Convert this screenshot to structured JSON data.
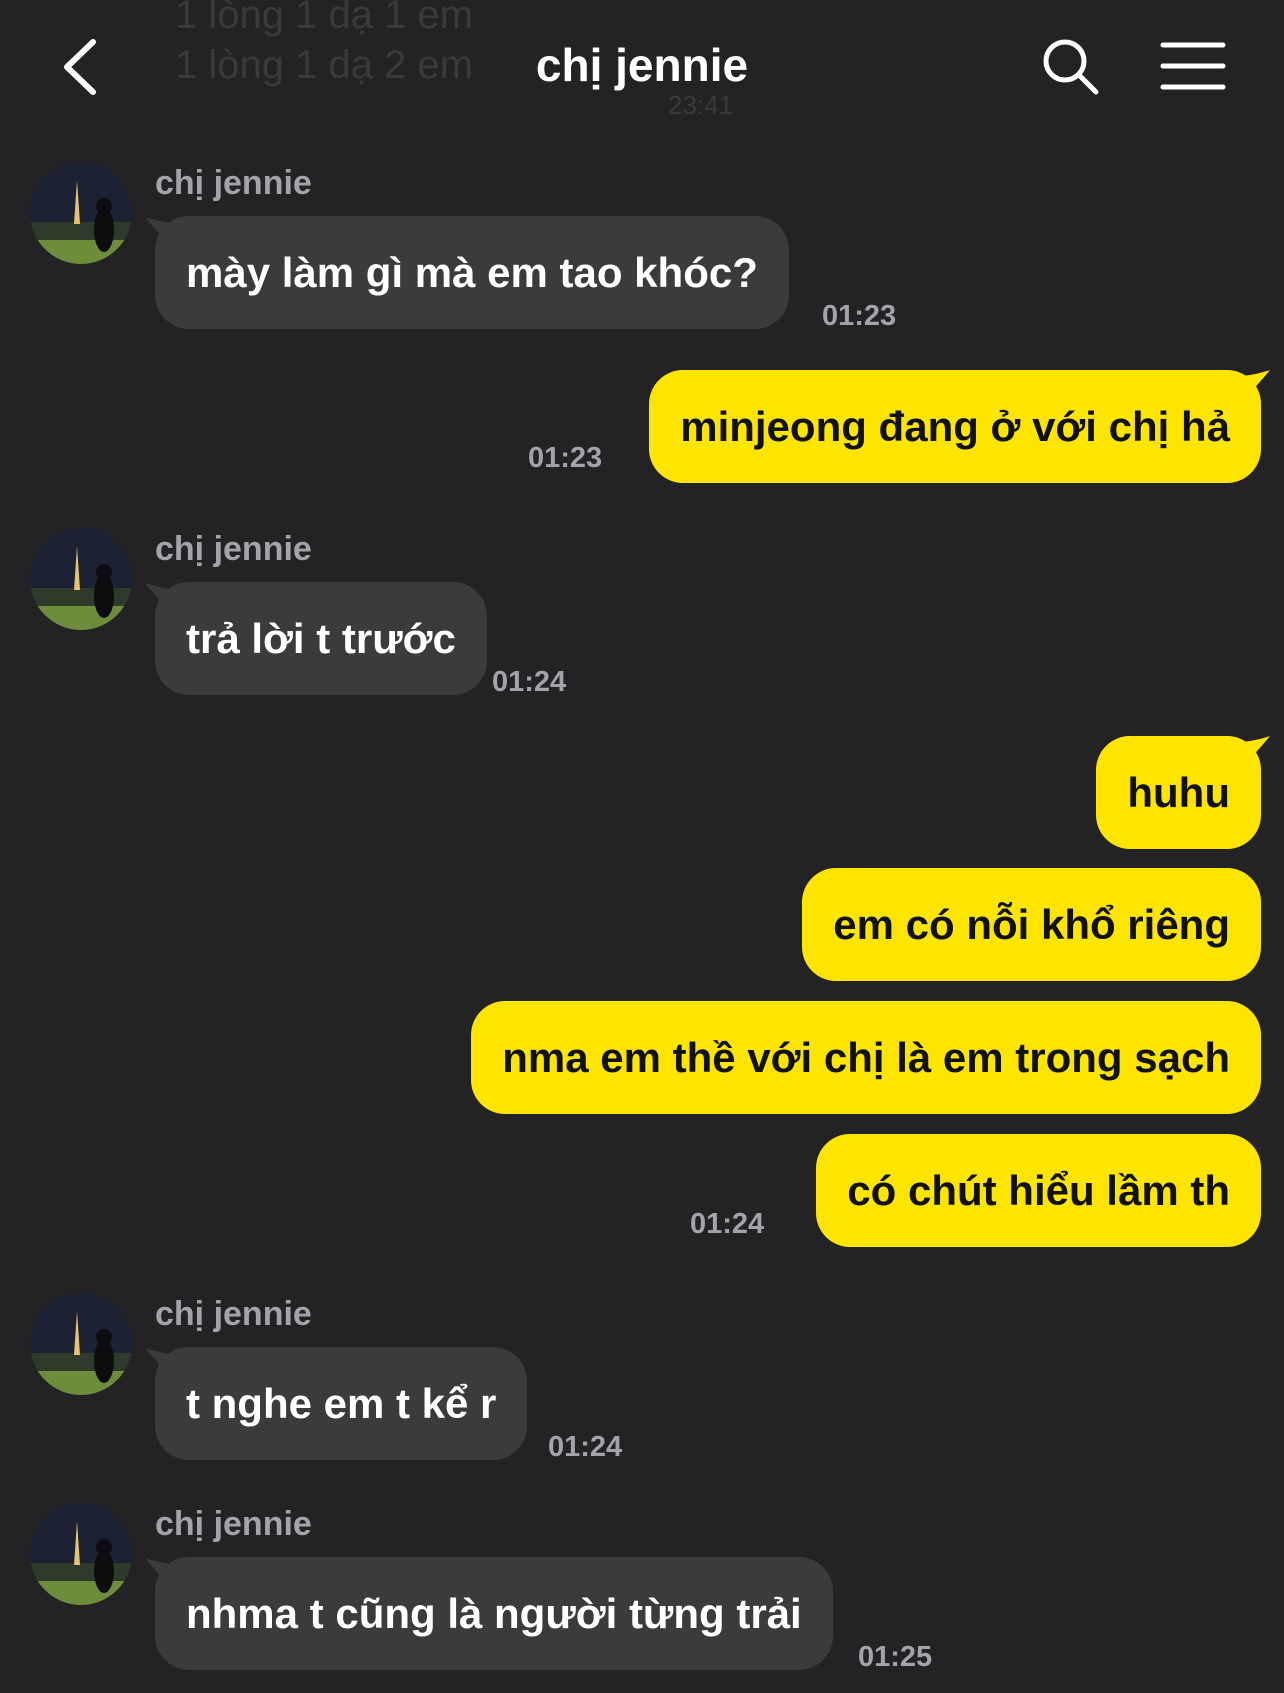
{
  "header": {
    "title": "chị jennie",
    "ghost_line_1": "1 lòng 1 dạ 1 em",
    "ghost_line_2": "1 lòng 1 dạ 2 em",
    "ghost_time": "23:41"
  },
  "messages": [
    {
      "direction": "in",
      "sender": "chị jennie",
      "text": "mày làm gì mà em tao khóc?",
      "time": "01:23"
    },
    {
      "direction": "out",
      "text": "minjeong đang ở với chị hả",
      "time": "01:23"
    },
    {
      "direction": "in",
      "sender": "chị jennie",
      "text": "trả lời t trước",
      "time": "01:24"
    },
    {
      "direction": "out",
      "text": "huhu"
    },
    {
      "direction": "out",
      "text": "em có nỗi khổ riêng"
    },
    {
      "direction": "out",
      "text": "nma em thề với chị là em trong sạch"
    },
    {
      "direction": "out",
      "text": "có chút hiểu lầm th",
      "time": "01:24"
    },
    {
      "direction": "in",
      "sender": "chị jennie",
      "text": "t nghe em t kể r",
      "time": "01:24"
    },
    {
      "direction": "in",
      "sender": "chị jennie",
      "text": "nhma t cũng là người từng trải",
      "time": "01:25"
    }
  ],
  "colors": {
    "background": "#232325",
    "incoming_bubble": "#3b3b3e",
    "outgoing_bubble": "#fde500",
    "secondary_text": "#a3a3a8"
  },
  "icons": {
    "back": "chevron-left-icon",
    "search": "search-icon",
    "menu": "hamburger-menu-icon"
  }
}
